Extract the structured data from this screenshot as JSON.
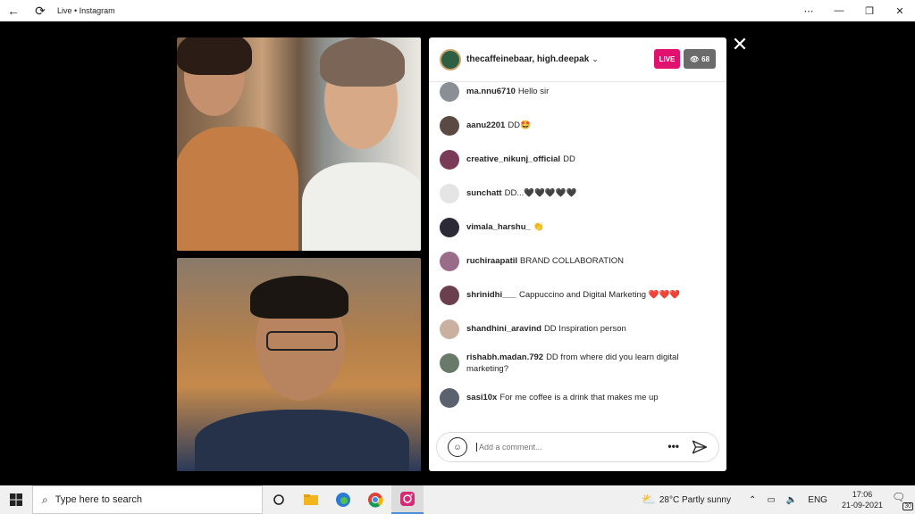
{
  "window": {
    "title": "Live • Instagram",
    "back_glyph": "←",
    "refresh_glyph": "⟳",
    "more_glyph": "⋯",
    "minimize_glyph": "—",
    "restore_glyph": "❐",
    "close_glyph": "✕"
  },
  "live": {
    "host_names": "thecaffeinebaar, high.deepak",
    "live_label": "LIVE",
    "viewer_count": "68",
    "close_glyph": "✕",
    "comment_placeholder": "Add a comment...",
    "more_glyph": "•••",
    "emoji_glyph": "☺",
    "comments": [
      {
        "user": "ma.nnu6710",
        "text": "Hello sir",
        "avatar_color": "#8a8f96"
      },
      {
        "user": "aanu2201",
        "text": "DD🤩",
        "avatar_color": "#5b4a43"
      },
      {
        "user": "creative_nikunj_official",
        "text": "DD",
        "avatar_color": "#7a3a58"
      },
      {
        "user": "sunchatt",
        "text": "DD...🖤🖤🖤🖤🖤",
        "avatar_color": "#e4e4e4"
      },
      {
        "user": "vimala_harshu_",
        "text": "👏",
        "avatar_color": "#2c2a36"
      },
      {
        "user": "ruchiraapatil",
        "text": "BRAND COLLABORATION",
        "avatar_color": "#9a6c8a"
      },
      {
        "user": "shrinidhi___",
        "text": "Cappuccino and Digital Marketing ❤️❤️❤️",
        "avatar_color": "#6b3f4e"
      },
      {
        "user": "shandhini_aravind",
        "text": "DD Inspiration person",
        "avatar_color": "#c9b0a0"
      },
      {
        "user": "rishabh.madan.792",
        "text": "DD from where did you learn digital marketing?",
        "avatar_color": "#6a7a6a"
      },
      {
        "user": "sasi10x",
        "text": "For me coffee is a drink that makes me up",
        "avatar_color": "#5a6270"
      }
    ]
  },
  "taskbar": {
    "search_placeholder": "Type here to search",
    "weather_temp": "28°C",
    "weather_text": "Partly sunny",
    "language": "ENG",
    "time": "17:06",
    "date": "21-09-2021",
    "notification_count": "30",
    "colors": {
      "explorer": "#f2b51d",
      "edge": "#2b7bd4",
      "chrome_red": "#db4437",
      "instagram": "#d62976"
    }
  }
}
